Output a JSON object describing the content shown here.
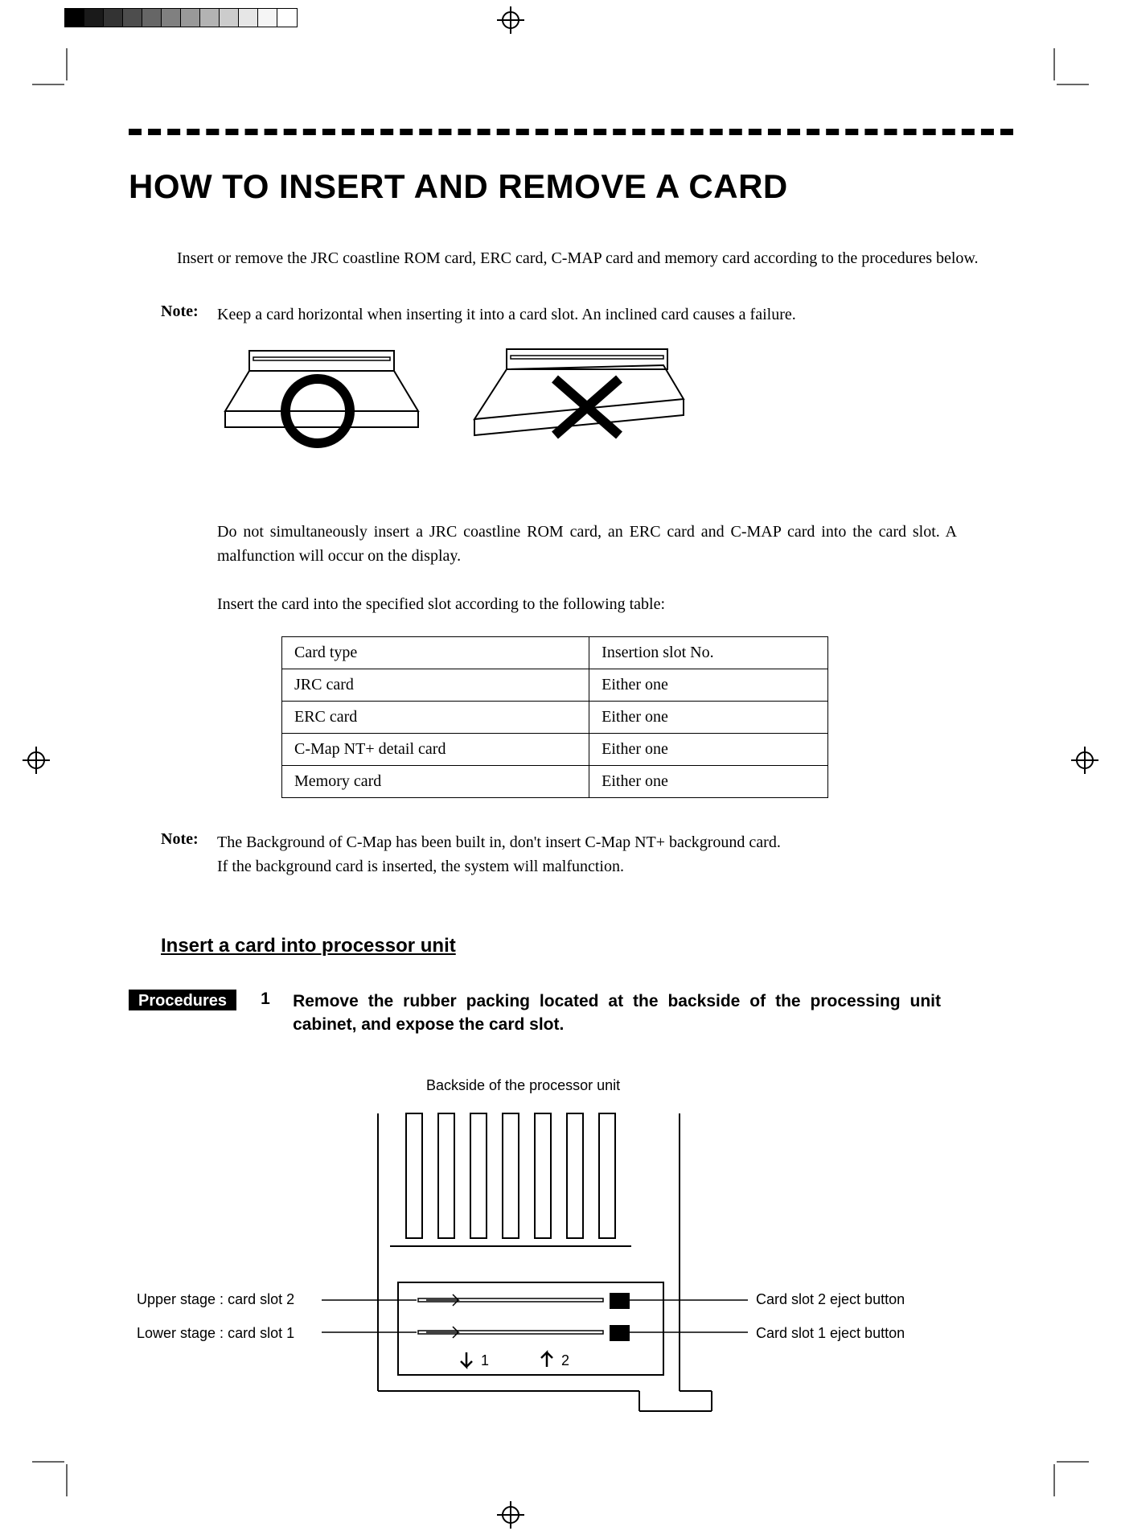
{
  "title": "HOW TO INSERT AND REMOVE A CARD",
  "intro": "Insert or remove the JRC coastline ROM card, ERC card, C-MAP card and memory card according to the procedures below.",
  "note1_label": "Note:",
  "note1_text": "Keep a card horizontal when inserting it into a card slot.    An inclined card causes a failure.",
  "body2": "Do not simultaneously insert a JRC coastline ROM card, an ERC card and C-MAP card into the card slot.    A malfunction will occur on the display.",
  "body3": "Insert the card into the specified slot according to the following table:",
  "table": {
    "header": [
      "Card type",
      "Insertion slot No."
    ],
    "rows": [
      [
        "JRC card",
        "Either one"
      ],
      [
        "ERC card",
        "Either one"
      ],
      [
        "C-Map NT+ detail card",
        "Either one"
      ],
      [
        "Memory card",
        "Either one"
      ]
    ]
  },
  "note2_label": "Note:",
  "note2_text": "The Background of C-Map has been built in, don't insert C-Map NT+ background card.\nIf the background card is inserted, the system will malfunction.",
  "subhead": "Insert a card into processor unit",
  "procedures_tag": "Procedures",
  "procedure_num": "1",
  "procedure_text": "Remove the rubber packing located at the backside of the processing unit cabinet, and expose the card slot.",
  "diagram": {
    "title": "Backside of the processor unit",
    "upper_label": "Upper stage : card slot 2",
    "lower_label": "Lower stage : card slot 1",
    "eject2_label": "Card slot 2 eject button",
    "eject1_label": "Card slot 1 eject button",
    "num1": "1",
    "num2": "2"
  }
}
